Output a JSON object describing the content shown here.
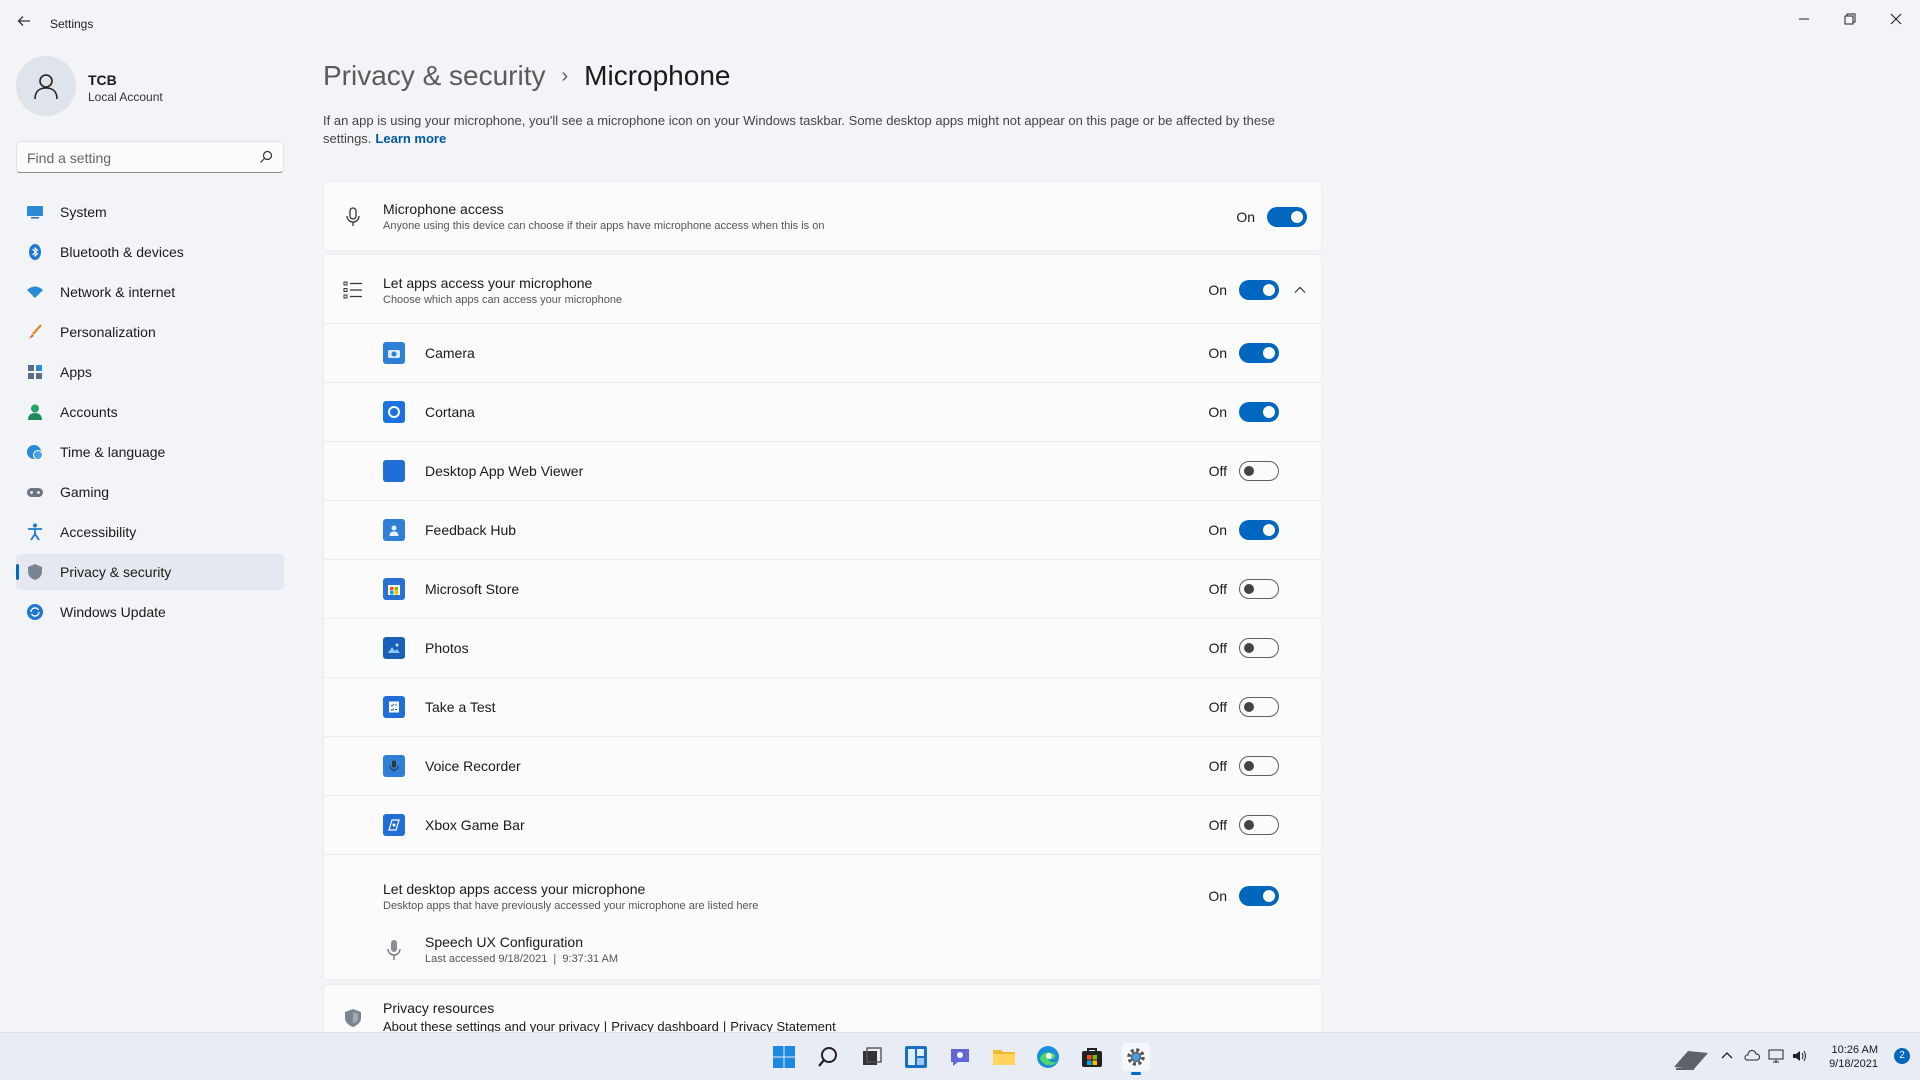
{
  "window": {
    "title": "Settings",
    "minimize_glyph": "—",
    "restore_glyph": "❐",
    "close_glyph": "✕"
  },
  "profile": {
    "name": "TCB",
    "account_type": "Local Account"
  },
  "search": {
    "placeholder": "Find a setting"
  },
  "sidebar": {
    "items": [
      {
        "label": "System",
        "icon": "system-icon",
        "active": false
      },
      {
        "label": "Bluetooth & devices",
        "icon": "bluetooth-icon",
        "active": false
      },
      {
        "label": "Network & internet",
        "icon": "wifi-icon",
        "active": false
      },
      {
        "label": "Personalization",
        "icon": "brush-icon",
        "active": false
      },
      {
        "label": "Apps",
        "icon": "apps-icon",
        "active": false
      },
      {
        "label": "Accounts",
        "icon": "person-icon",
        "active": false
      },
      {
        "label": "Time & language",
        "icon": "globe-clock-icon",
        "active": false
      },
      {
        "label": "Gaming",
        "icon": "gamepad-icon",
        "active": false
      },
      {
        "label": "Accessibility",
        "icon": "accessibility-icon",
        "active": false
      },
      {
        "label": "Privacy & security",
        "icon": "shield-icon",
        "active": true
      },
      {
        "label": "Windows Update",
        "icon": "update-icon",
        "active": false
      }
    ]
  },
  "page": {
    "breadcrumb_parent": "Privacy & security",
    "breadcrumb_sep": "›",
    "title": "Microphone",
    "intro": "If an app is using your microphone, you'll see a microphone icon on your Windows taskbar. Some desktop apps might not appear on this page or be affected by these settings.",
    "learn_more": "Learn more"
  },
  "mic_access": {
    "title": "Microphone access",
    "description": "Anyone using this device can choose if their apps have microphone access when this is on",
    "state": "On",
    "on": true
  },
  "apps_access": {
    "title": "Let apps access your microphone",
    "description": "Choose which apps can access your microphone",
    "state": "On",
    "on": true,
    "expanded": true,
    "apps": [
      {
        "name": "Camera",
        "state": "On",
        "on": true,
        "icon": "camera-icon"
      },
      {
        "name": "Cortana",
        "state": "On",
        "on": true,
        "icon": "cortana-icon"
      },
      {
        "name": "Desktop App Web Viewer",
        "state": "Off",
        "on": false,
        "icon": "web-viewer-icon"
      },
      {
        "name": "Feedback Hub",
        "state": "On",
        "on": true,
        "icon": "feedback-hub-icon"
      },
      {
        "name": "Microsoft Store",
        "state": "Off",
        "on": false,
        "icon": "store-icon"
      },
      {
        "name": "Photos",
        "state": "Off",
        "on": false,
        "icon": "photos-icon"
      },
      {
        "name": "Take a Test",
        "state": "Off",
        "on": false,
        "icon": "take-a-test-icon"
      },
      {
        "name": "Voice Recorder",
        "state": "Off",
        "on": false,
        "icon": "voice-recorder-icon"
      },
      {
        "name": "Xbox Game Bar",
        "state": "Off",
        "on": false,
        "icon": "xbox-game-bar-icon"
      }
    ]
  },
  "desktop_apps": {
    "title": "Let desktop apps access your microphone",
    "description": "Desktop apps that have previously accessed your microphone are listed here",
    "state": "On",
    "on": true,
    "entries": [
      {
        "name": "Speech UX Configuration",
        "last_accessed": "Last accessed 9/18/2021  |  9:37:31 AM"
      }
    ]
  },
  "privacy_resources": {
    "title": "Privacy resources",
    "links": [
      "About these settings and your privacy",
      "Privacy dashboard",
      "Privacy Statement"
    ],
    "sep": "|"
  },
  "taskbar": {
    "time": "10:26 AM",
    "date": "9/18/2021",
    "notification_count": "2",
    "apps": [
      "start-icon",
      "search-icon",
      "task-view-icon",
      "widgets-icon",
      "chat-icon",
      "file-explorer-icon",
      "edge-icon",
      "store-icon",
      "settings-icon"
    ]
  },
  "colors": {
    "accent": "#0067c0",
    "background": "#f2f4f8",
    "card": "#fbfbfc"
  }
}
